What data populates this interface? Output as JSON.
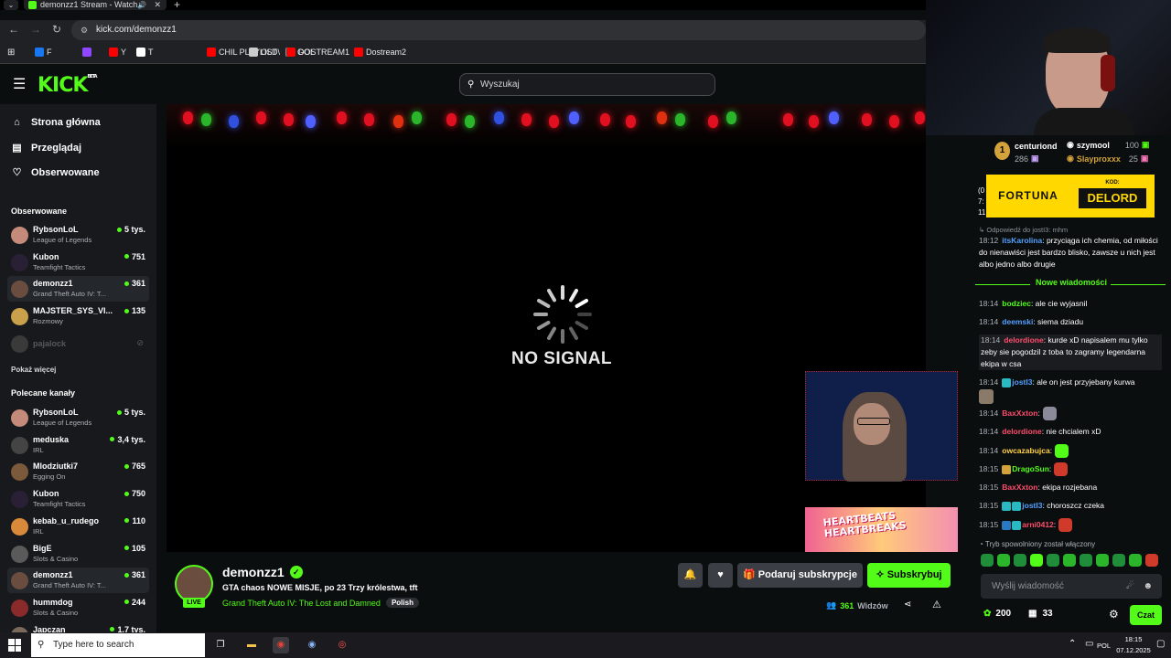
{
  "browser": {
    "tab_title": "demonzz1 Stream - Watch",
    "url": "kick.com/demonzz1",
    "bookmarks": [
      {
        "label": "F",
        "icon": "facebook-icon",
        "color": "#1877f2"
      },
      {
        "label": "",
        "icon": "twitch-icon",
        "color": "#9146ff"
      },
      {
        "label": "Y",
        "icon": "youtube-icon",
        "color": "#ff0000"
      },
      {
        "label": "T",
        "icon": "x-icon",
        "color": "#ffffff"
      },
      {
        "label": "CHIL PLAYLIST",
        "icon": "youtube-icon",
        "color": "#ff0000"
      },
      {
        "label": "OLD\\",
        "icon": "folder-icon",
        "color": "#cccccc"
      },
      {
        "label": "GOL",
        "icon": "g-icon",
        "color": "#2ab8c3"
      },
      {
        "label": "DOSTREAM1",
        "icon": "youtube-icon",
        "color": "#ff0000"
      },
      {
        "label": "Dostream2",
        "icon": "youtube-icon",
        "color": "#ff0000"
      }
    ]
  },
  "kick": {
    "logo": "KICK",
    "logo_sup": "BETA",
    "search_placeholder": "Wyszukaj",
    "accent": "#53fc18"
  },
  "sidebar": {
    "nav": [
      {
        "label": "Strona główna",
        "icon": "home-icon"
      },
      {
        "label": "Przeglądaj",
        "icon": "browse-icon"
      },
      {
        "label": "Obserwowane",
        "icon": "heart-icon"
      }
    ],
    "followed_header": "Obserwowane",
    "followed": [
      {
        "name": "RybsonLoL",
        "game": "League of Legends",
        "viewers": "5 tys.",
        "color": "#c48a7a"
      },
      {
        "name": "Kubon",
        "game": "Teamfight Tactics",
        "viewers": "751",
        "color": "#2a2035"
      },
      {
        "name": "demonzz1",
        "game": "Grand Theft Auto IV: T...",
        "viewers": "361",
        "color": "#6b4d3f",
        "active": true
      },
      {
        "name": "MAJSTER_SYS_VI...",
        "game": "Rozmowy",
        "viewers": "135",
        "color": "#c9a14a"
      },
      {
        "name": "pajalock",
        "game": "",
        "viewers": "",
        "color": "#3a3a3a",
        "offline": true
      }
    ],
    "show_more": "Pokaż więcej",
    "recommended_header": "Polecane kanały",
    "recommended": [
      {
        "name": "RybsonLoL",
        "game": "League of Legends",
        "viewers": "5 tys.",
        "color": "#c48a7a"
      },
      {
        "name": "meduska",
        "game": "IRL",
        "viewers": "3,4 tys.",
        "color": "#444444"
      },
      {
        "name": "Mlodziutki7",
        "game": "Egging On",
        "viewers": "765",
        "color": "#7a5a3a"
      },
      {
        "name": "Kubon",
        "game": "Teamfight Tactics",
        "viewers": "750",
        "color": "#2a2035"
      },
      {
        "name": "kebab_u_rudego",
        "game": "IRL",
        "viewers": "110",
        "color": "#d88a3a"
      },
      {
        "name": "BigE",
        "game": "Slots & Casino",
        "viewers": "105",
        "color": "#5a5a5a"
      },
      {
        "name": "demonzz1",
        "game": "Grand Theft Auto IV: T...",
        "viewers": "361",
        "color": "#6b4d3f",
        "active": true
      },
      {
        "name": "hummdog",
        "game": "Slots & Casino",
        "viewers": "244",
        "color": "#8a2a2a"
      },
      {
        "name": "Japczan",
        "game": "",
        "viewers": "1,7 tys.",
        "color": "#7a6a5a"
      }
    ]
  },
  "player": {
    "status": "NO SIGNAL",
    "banner_text": "HEARTBEATS HEARTBREAKS"
  },
  "stream": {
    "name": "demonzz1",
    "live": "LIVE",
    "title": "GTA chaos NOWE MISJE, po 23 Trzy królestwa, tft",
    "game": "Grand Theft Auto IV: The Lost and Damned",
    "language": "Polish",
    "subscribe_gift": "Podaruj subskrypcje",
    "subscribe": "Subskrybuj",
    "viewers": "361",
    "viewers_label": "Widzów"
  },
  "chat": {
    "pinned": {
      "rank": "1",
      "u1": "centuriond",
      "u1_count": "286",
      "u2": "szymool",
      "u2_count": "100",
      "u3": "Slayproxxx",
      "u3_count": "25"
    },
    "sponsor": "FORTUNA",
    "code_label": "KOD:",
    "code": "DELORD",
    "partial_lines": [
      "(0",
      "7:",
      "11"
    ],
    "reply_to": "Odpowiedź do jostI3: mhm",
    "first_msg": {
      "time": "18:12",
      "user": "itsKarolina",
      "text": ": przyciąga ich chemia, od miłości do nienawiści jest bardzo blisko, zawsze u nich jest albo jedno albo drugie",
      "color": "#53a0ff"
    },
    "new_messages": "Nowe wiadomości",
    "messages": [
      {
        "time": "18:14",
        "user": "bodziec",
        "text": ": ale cie wyjasnil",
        "color": "#53fc18"
      },
      {
        "time": "18:14",
        "user": "deemski",
        "text": ": siema dziadu",
        "color": "#53a0ff"
      },
      {
        "time": "18:14",
        "user": "delordione",
        "text": ": kurde xD napisalem mu tylko zeby sie pogodzil z toba to zagramy legendarna ekipa w csa",
        "color": "#ff4d6d"
      },
      {
        "time": "18:14",
        "user": "jostI3",
        "text": ": ale on jest przyjebany kurwa",
        "color": "#53a0ff"
      },
      {
        "time": "18:14",
        "user": "BaxXxton",
        "text": ":",
        "color": "#ff4d6d"
      },
      {
        "time": "18:14",
        "user": "delordione",
        "text": ": nie chcialem xD",
        "color": "#ff4d6d"
      },
      {
        "time": "18:14",
        "user": "owcazabujca",
        "text": ":",
        "color": "#ffd24a"
      },
      {
        "time": "18:15",
        "user": "DragoSun",
        "text": ":",
        "color": "#53fc18"
      },
      {
        "time": "18:15",
        "user": "BaxXxton",
        "text": ": ekipa rozjebana",
        "color": "#ff4d6d"
      },
      {
        "time": "18:15",
        "user": "jostI3",
        "text": ": choroszcz czeka",
        "color": "#53a0ff"
      },
      {
        "time": "18:15",
        "user": "arni0412",
        "text": ":",
        "color": "#ff4d6d"
      }
    ],
    "slow_mode": "Tryb spowolniony został włączony",
    "input_placeholder": "Wyślij wiadomość",
    "points": "200",
    "gifts": "33",
    "send": "Czat"
  },
  "taskbar": {
    "search_placeholder": "Type here to search",
    "lang": "POL",
    "time": "18:15",
    "date": "07.12.2025"
  }
}
